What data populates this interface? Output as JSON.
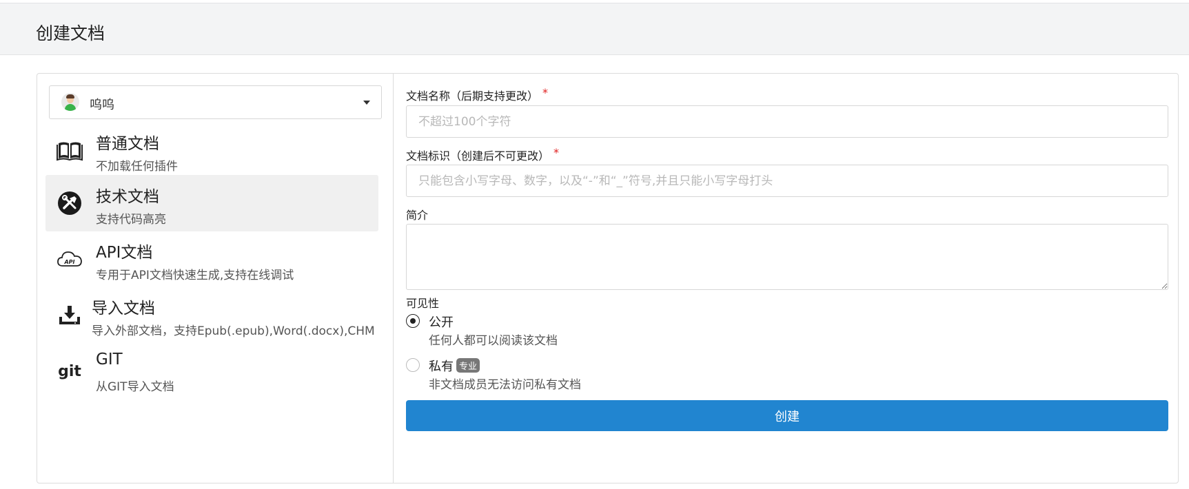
{
  "page": {
    "title": "创建文档"
  },
  "owner": {
    "name": "呜呜"
  },
  "doc_types": [
    {
      "title": "普通文档",
      "desc": "不加载任何插件",
      "icon": "open-book-icon",
      "active": false
    },
    {
      "title": "技术文档",
      "desc": "支持代码高亮",
      "icon": "tools-icon",
      "active": true
    },
    {
      "title": "API文档",
      "desc": "专用于API文档快速生成,支持在线调试",
      "icon": "cloud-api-icon",
      "active": false
    },
    {
      "title": "导入文档",
      "desc": "导入外部文档，支持Epub(.epub),Word(.docx),CHM(.chm)",
      "icon": "import-icon",
      "active": false
    },
    {
      "title": "GIT",
      "desc": "从GIT导入文档",
      "icon": "git-icon",
      "active": false
    }
  ],
  "form": {
    "name_label": "文档名称（后期支持更改）",
    "name_placeholder": "不超过100个字符",
    "identify_label": "文档标识（创建后不可更改）",
    "identify_placeholder": "只能包含小写字母、数字，以及“-”和“_”符号,并且只能小写字母打头",
    "required_mark": "*",
    "description_label": "简介",
    "description_value": "",
    "visibility_label": "可见性",
    "visibility_options": [
      {
        "label": "公开",
        "desc": "任何人都可以阅读该文档",
        "checked": true,
        "badge": ""
      },
      {
        "label": "私有",
        "desc": "非文档成员无法访问私有文档",
        "checked": false,
        "badge": "专业"
      }
    ],
    "submit_label": "创建"
  },
  "colors": {
    "primary": "#2185d0",
    "required": "#e02020",
    "header_bg": "#f3f4f5"
  }
}
